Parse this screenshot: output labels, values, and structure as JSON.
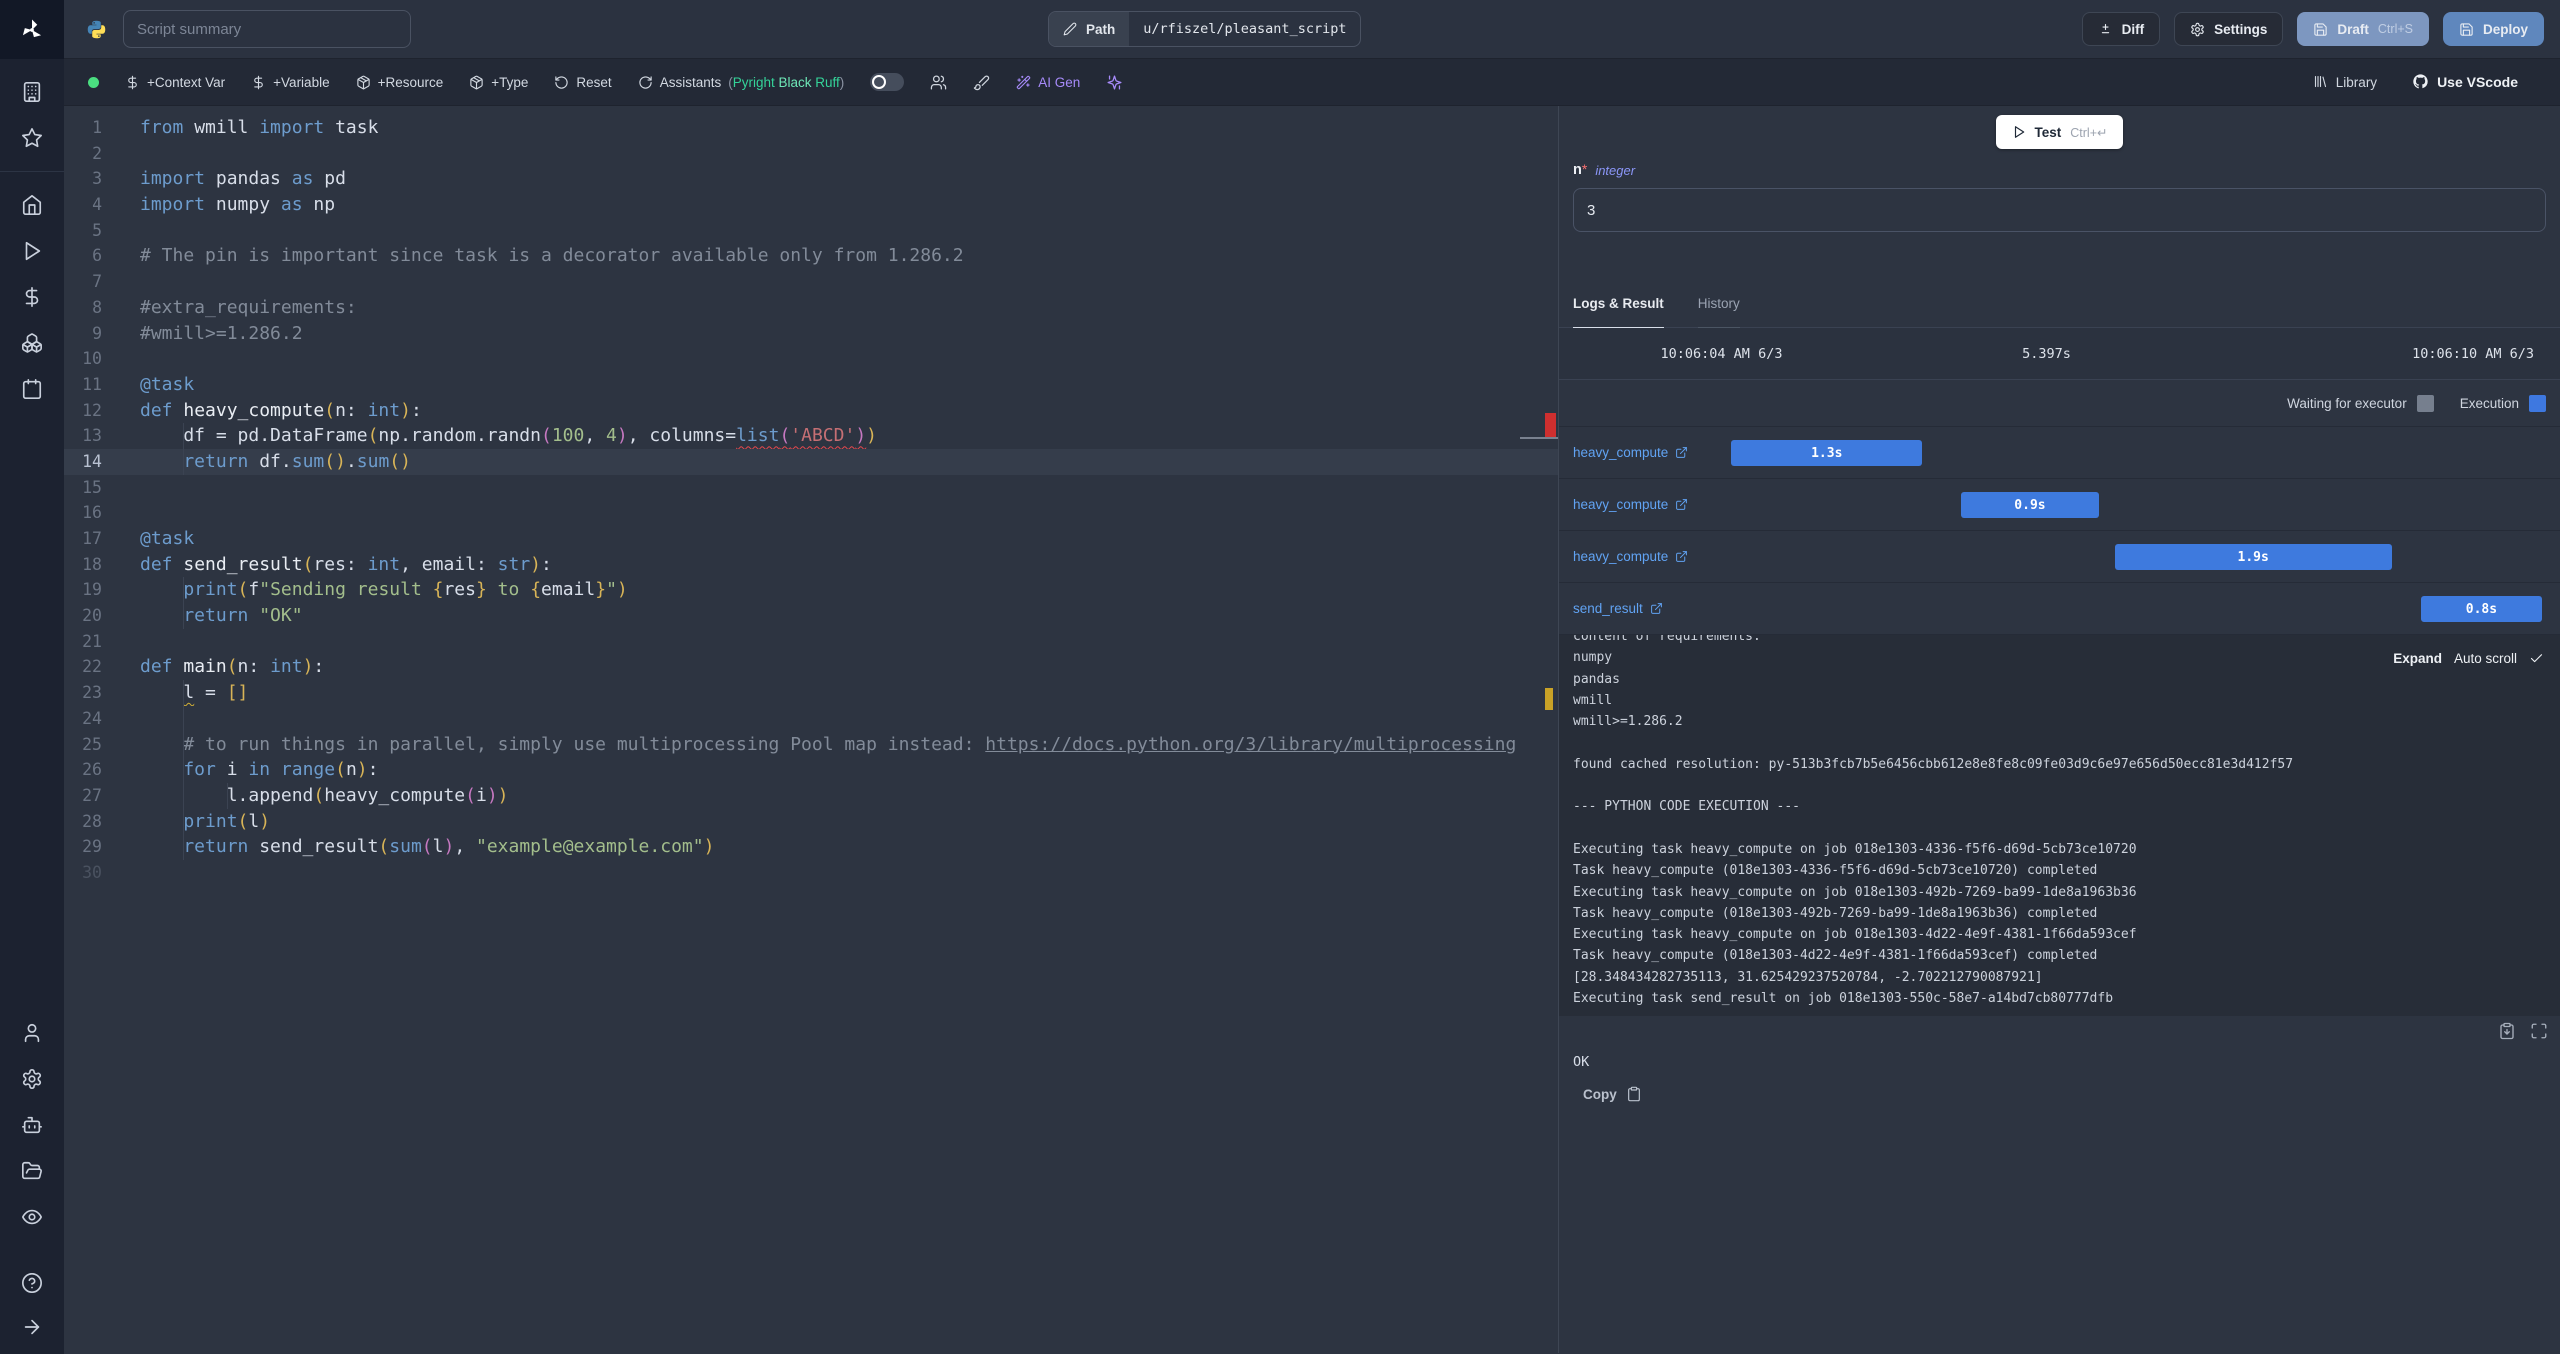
{
  "colors": {
    "accent_blue_bar": "#3e7ade",
    "draft_button": "#7d97c0",
    "deploy_button": "#5f87bd",
    "ai_purple": "#a78bfa",
    "error_marker": "#cf2f2f",
    "warning_marker": "#c9a227",
    "status_dot": "#4ade80"
  },
  "rail": {
    "top": [
      "building",
      "star"
    ],
    "middle": [
      "home",
      "play",
      "dollar",
      "boxes",
      "calendar"
    ],
    "bottom": [
      "user",
      "gear",
      "bot",
      "folder-open",
      "eye"
    ],
    "footer": [
      "help-circle",
      "arrow-right"
    ]
  },
  "header": {
    "summary_placeholder": "Script summary",
    "path": {
      "label": "Path",
      "value": "u/rfiszel/pleasant_script"
    },
    "buttons": {
      "diff": "Diff",
      "settings": "Settings",
      "draft": "Draft",
      "draft_shortcut": "Ctrl+S",
      "deploy": "Deploy"
    }
  },
  "toolbar": {
    "add_context_var": "+Context Var",
    "add_variable": "+Variable",
    "add_resource": "+Resource",
    "add_type": "+Type",
    "reset": "Reset",
    "assistants": "Assistants",
    "assistants_detail": {
      "open": "(",
      "items": [
        {
          "label": "Pyright",
          "color": "#34d399"
        },
        {
          "label": "Black",
          "color": "#6ee7b7"
        },
        {
          "label": "Ruff",
          "color": "#34d399"
        }
      ],
      "close": ")"
    },
    "ai_gen": "AI Gen",
    "library": "Library",
    "use_vscode": "Use VScode"
  },
  "editor": {
    "lines": [
      {
        "n": 1,
        "t": [
          [
            "kw",
            "from"
          ],
          [
            "fg",
            " wmill "
          ],
          [
            "kw",
            "import"
          ],
          [
            "fg",
            " task"
          ]
        ]
      },
      {
        "n": 2,
        "t": []
      },
      {
        "n": 3,
        "t": [
          [
            "kw",
            "import"
          ],
          [
            "fg",
            " pandas "
          ],
          [
            "kw",
            "as"
          ],
          [
            "fg",
            " pd"
          ]
        ]
      },
      {
        "n": 4,
        "t": [
          [
            "kw",
            "import"
          ],
          [
            "fg",
            " numpy "
          ],
          [
            "kw",
            "as"
          ],
          [
            "fg",
            " np"
          ]
        ]
      },
      {
        "n": 5,
        "t": []
      },
      {
        "n": 6,
        "t": [
          [
            "cm",
            "# The pin is important since task is a decorator available only from 1.286.2"
          ]
        ]
      },
      {
        "n": 7,
        "t": []
      },
      {
        "n": 8,
        "t": [
          [
            "cm",
            "#extra_requirements:"
          ]
        ]
      },
      {
        "n": 9,
        "t": [
          [
            "cm",
            "#wmill>=1.286.2"
          ]
        ]
      },
      {
        "n": 10,
        "t": []
      },
      {
        "n": 11,
        "t": [
          [
            "kw",
            "@task"
          ]
        ]
      },
      {
        "n": 12,
        "t": [
          [
            "kw",
            "def"
          ],
          [
            "fnm",
            " heavy_compute"
          ],
          [
            "br1",
            "("
          ],
          [
            "fg",
            "n: "
          ],
          [
            "kw",
            "int"
          ],
          [
            "br1",
            ")"
          ],
          [
            "fg",
            ":"
          ]
        ]
      },
      {
        "n": 13,
        "g": [
          4
        ],
        "t": [
          [
            "fg",
            "    df = pd.DataFrame"
          ],
          [
            "br1",
            "("
          ],
          [
            "fg",
            "np.random.randn"
          ],
          [
            "br2",
            "("
          ],
          [
            "num",
            "100"
          ],
          [
            "fg",
            ", "
          ],
          [
            "num",
            "4"
          ],
          [
            "br2",
            ")"
          ],
          [
            "fg",
            ", columns="
          ],
          [
            "kw sq",
            "list"
          ],
          [
            "br2 sq",
            "("
          ],
          [
            "strr sq",
            "'ABCD'"
          ],
          [
            "br2 sq",
            ")"
          ],
          [
            "br1",
            ")"
          ]
        ]
      },
      {
        "n": 14,
        "cur": true,
        "g": [
          4
        ],
        "t": [
          [
            "kw",
            "    return"
          ],
          [
            "fg",
            " df."
          ],
          [
            "kw",
            "sum"
          ],
          [
            "br1",
            "()"
          ],
          [
            "fg",
            "."
          ],
          [
            "kw",
            "sum"
          ],
          [
            "br1",
            "()"
          ]
        ]
      },
      {
        "n": 15,
        "t": []
      },
      {
        "n": 16,
        "t": []
      },
      {
        "n": 17,
        "t": [
          [
            "kw",
            "@task"
          ]
        ]
      },
      {
        "n": 18,
        "t": [
          [
            "kw",
            "def"
          ],
          [
            "fnm",
            " send_result"
          ],
          [
            "br1",
            "("
          ],
          [
            "fg",
            "res: "
          ],
          [
            "kw",
            "int"
          ],
          [
            "fg",
            ", email: "
          ],
          [
            "kw",
            "str"
          ],
          [
            "br1",
            ")"
          ],
          [
            "fg",
            ":"
          ]
        ]
      },
      {
        "n": 19,
        "g": [
          4
        ],
        "t": [
          [
            "kw",
            "    print"
          ],
          [
            "br1",
            "("
          ],
          [
            "fg",
            "f"
          ],
          [
            "str",
            "\"Sending result "
          ],
          [
            "br1",
            "{"
          ],
          [
            "fg",
            "res"
          ],
          [
            "br1",
            "}"
          ],
          [
            "str",
            " to "
          ],
          [
            "br1",
            "{"
          ],
          [
            "fg",
            "email"
          ],
          [
            "br1",
            "}"
          ],
          [
            "str",
            "\""
          ],
          [
            "br1",
            ")"
          ]
        ]
      },
      {
        "n": 20,
        "g": [
          4
        ],
        "t": [
          [
            "kw",
            "    return"
          ],
          [
            "str",
            " \"OK\""
          ]
        ]
      },
      {
        "n": 21,
        "t": []
      },
      {
        "n": 22,
        "t": [
          [
            "kw",
            "def"
          ],
          [
            "fnm",
            " main"
          ],
          [
            "br1",
            "("
          ],
          [
            "fg",
            "n: "
          ],
          [
            "kw",
            "int"
          ],
          [
            "br1",
            ")"
          ],
          [
            "fg",
            ":"
          ]
        ]
      },
      {
        "n": 23,
        "g": [
          4
        ],
        "t": [
          [
            "fg",
            "    "
          ],
          [
            "fg sqy",
            "l"
          ],
          [
            "fg",
            " = "
          ],
          [
            "br1",
            "[]"
          ]
        ]
      },
      {
        "n": 24,
        "g": [
          4
        ],
        "t": []
      },
      {
        "n": 25,
        "g": [
          4
        ],
        "t": [
          [
            "cm",
            "    # to run things in parallel, simply use multiprocessing Pool map instead: "
          ],
          [
            "cm lnk",
            "https://docs.python.org/3/library/multiprocessing"
          ]
        ]
      },
      {
        "n": 26,
        "g": [
          4
        ],
        "t": [
          [
            "kw",
            "    for"
          ],
          [
            "fg",
            " i "
          ],
          [
            "kw",
            "in"
          ],
          [
            "kw",
            " range"
          ],
          [
            "br1",
            "("
          ],
          [
            "fg",
            "n"
          ],
          [
            "br1",
            ")"
          ],
          [
            "fg",
            ":"
          ]
        ]
      },
      {
        "n": 27,
        "g": [
          4,
          8
        ],
        "t": [
          [
            "fg",
            "        l.append"
          ],
          [
            "br1",
            "("
          ],
          [
            "fg",
            "heavy_compute"
          ],
          [
            "br2",
            "("
          ],
          [
            "fg",
            "i"
          ],
          [
            "br2",
            ")"
          ],
          [
            "br1",
            ")"
          ]
        ]
      },
      {
        "n": 28,
        "g": [
          4
        ],
        "t": [
          [
            "kw",
            "    print"
          ],
          [
            "br1",
            "("
          ],
          [
            "fg",
            "l"
          ],
          [
            "br1",
            ")"
          ]
        ]
      },
      {
        "n": 29,
        "g": [
          4
        ],
        "t": [
          [
            "kw",
            "    return"
          ],
          [
            "fg",
            " send_result"
          ],
          [
            "br1",
            "("
          ],
          [
            "kw",
            "sum"
          ],
          [
            "br2",
            "("
          ],
          [
            "fg",
            "l"
          ],
          [
            "br2",
            ")"
          ],
          [
            "fg",
            ", "
          ],
          [
            "str",
            "\"example@example.com\""
          ],
          [
            "br1",
            ")"
          ]
        ]
      },
      {
        "n": 30,
        "dim": true,
        "t": []
      }
    ],
    "markers": {
      "error_line": 13,
      "warning_line": 23
    }
  },
  "run_panel": {
    "test": {
      "label": "Test",
      "shortcut": "Ctrl+↵"
    },
    "arg": {
      "name": "n",
      "required_mark": "*",
      "type": "integer",
      "value": "3"
    },
    "tabs": {
      "logs_result": "Logs & Result",
      "history": "History"
    },
    "run_meta": {
      "started": "10:06:04 AM 6/3",
      "duration": "5.397s",
      "ended": "10:06:10 AM 6/3"
    },
    "legend": {
      "waiting": "Waiting for executor",
      "waiting_color": "#767f8e",
      "execution": "Execution",
      "execution_color": "#3e78e0"
    },
    "timeline": [
      {
        "name": "heavy_compute",
        "duration": "1.3s",
        "left_pct": 17.2,
        "width_pct": 19.1
      },
      {
        "name": "heavy_compute",
        "duration": "0.9s",
        "left_pct": 40.2,
        "width_pct": 13.7
      },
      {
        "name": "heavy_compute",
        "duration": "1.9s",
        "left_pct": 55.5,
        "width_pct": 27.7
      },
      {
        "name": "send_result",
        "duration": "0.8s",
        "left_pct": 86.1,
        "width_pct": 12.1
      }
    ],
    "logs": {
      "expand": "Expand",
      "autoscroll": "Auto scroll",
      "lines": [
        "content of requirements:",
        "numpy",
        "pandas",
        "wmill",
        "wmill>=1.286.2",
        "",
        "found cached resolution: py-513b3fcb7b5e6456cbb612e8e8fe8c09fe03d9c6e97e656d50ecc81e3d412f57",
        "",
        "--- PYTHON CODE EXECUTION ---",
        "",
        "Executing task heavy_compute on job 018e1303-4336-f5f6-d69d-5cb73ce10720",
        "Task heavy_compute (018e1303-4336-f5f6-d69d-5cb73ce10720) completed",
        "Executing task heavy_compute on job 018e1303-492b-7269-ba99-1de8a1963b36",
        "Task heavy_compute (018e1303-492b-7269-ba99-1de8a1963b36) completed",
        "Executing task heavy_compute on job 018e1303-4d22-4e9f-4381-1f66da593cef",
        "Task heavy_compute (018e1303-4d22-4e9f-4381-1f66da593cef) completed",
        "[28.348434282735113, 31.625429237520784, -2.702212790087921]",
        "Executing task send_result on job 018e1303-550c-58e7-a14bd7cb80777dfb"
      ]
    },
    "result": {
      "value": "OK",
      "copy": "Copy"
    }
  }
}
